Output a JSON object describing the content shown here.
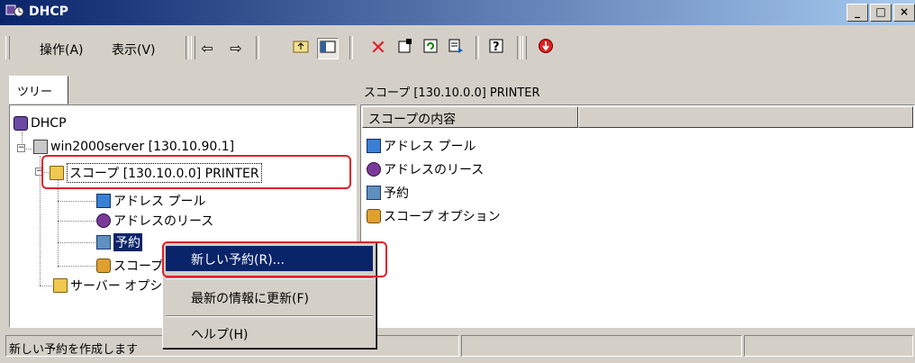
{
  "window": {
    "title": "DHCP"
  },
  "menu": {
    "action": "操作(A)",
    "view": "表示(V)"
  },
  "toolbar": {
    "icons": [
      "back-arrow-icon",
      "forward-arrow-icon",
      "up-folder-icon",
      "show-tree-icon",
      "delete-icon",
      "properties-icon",
      "refresh-icon",
      "export-list-icon",
      "help-icon",
      "stop-icon"
    ]
  },
  "tree": {
    "tab_label": "ツリー",
    "root": "DHCP",
    "server": "win2000server [130.10.90.1]",
    "scope": "スコープ [130.10.0.0] PRINTER",
    "children": [
      "アドレス プール",
      "アドレスのリース",
      "予約",
      "スコープ オプション"
    ],
    "server_options": "サーバー オプション"
  },
  "list": {
    "header_path": "スコープ [130.10.0.0] PRINTER",
    "column": "スコープの内容",
    "items": [
      "アドレス プール",
      "アドレスのリース",
      "予約",
      "スコープ オプション"
    ]
  },
  "context_menu": {
    "new_reservation": "新しい予約(R)...",
    "refresh": "最新の情報に更新(F)",
    "help": "ヘルプ(H)"
  },
  "status": {
    "text": "新しい予約を作成します"
  },
  "colors": {
    "highlight": "#0a246a",
    "annotation": "#e0202a",
    "face": "#d4d0c8"
  }
}
